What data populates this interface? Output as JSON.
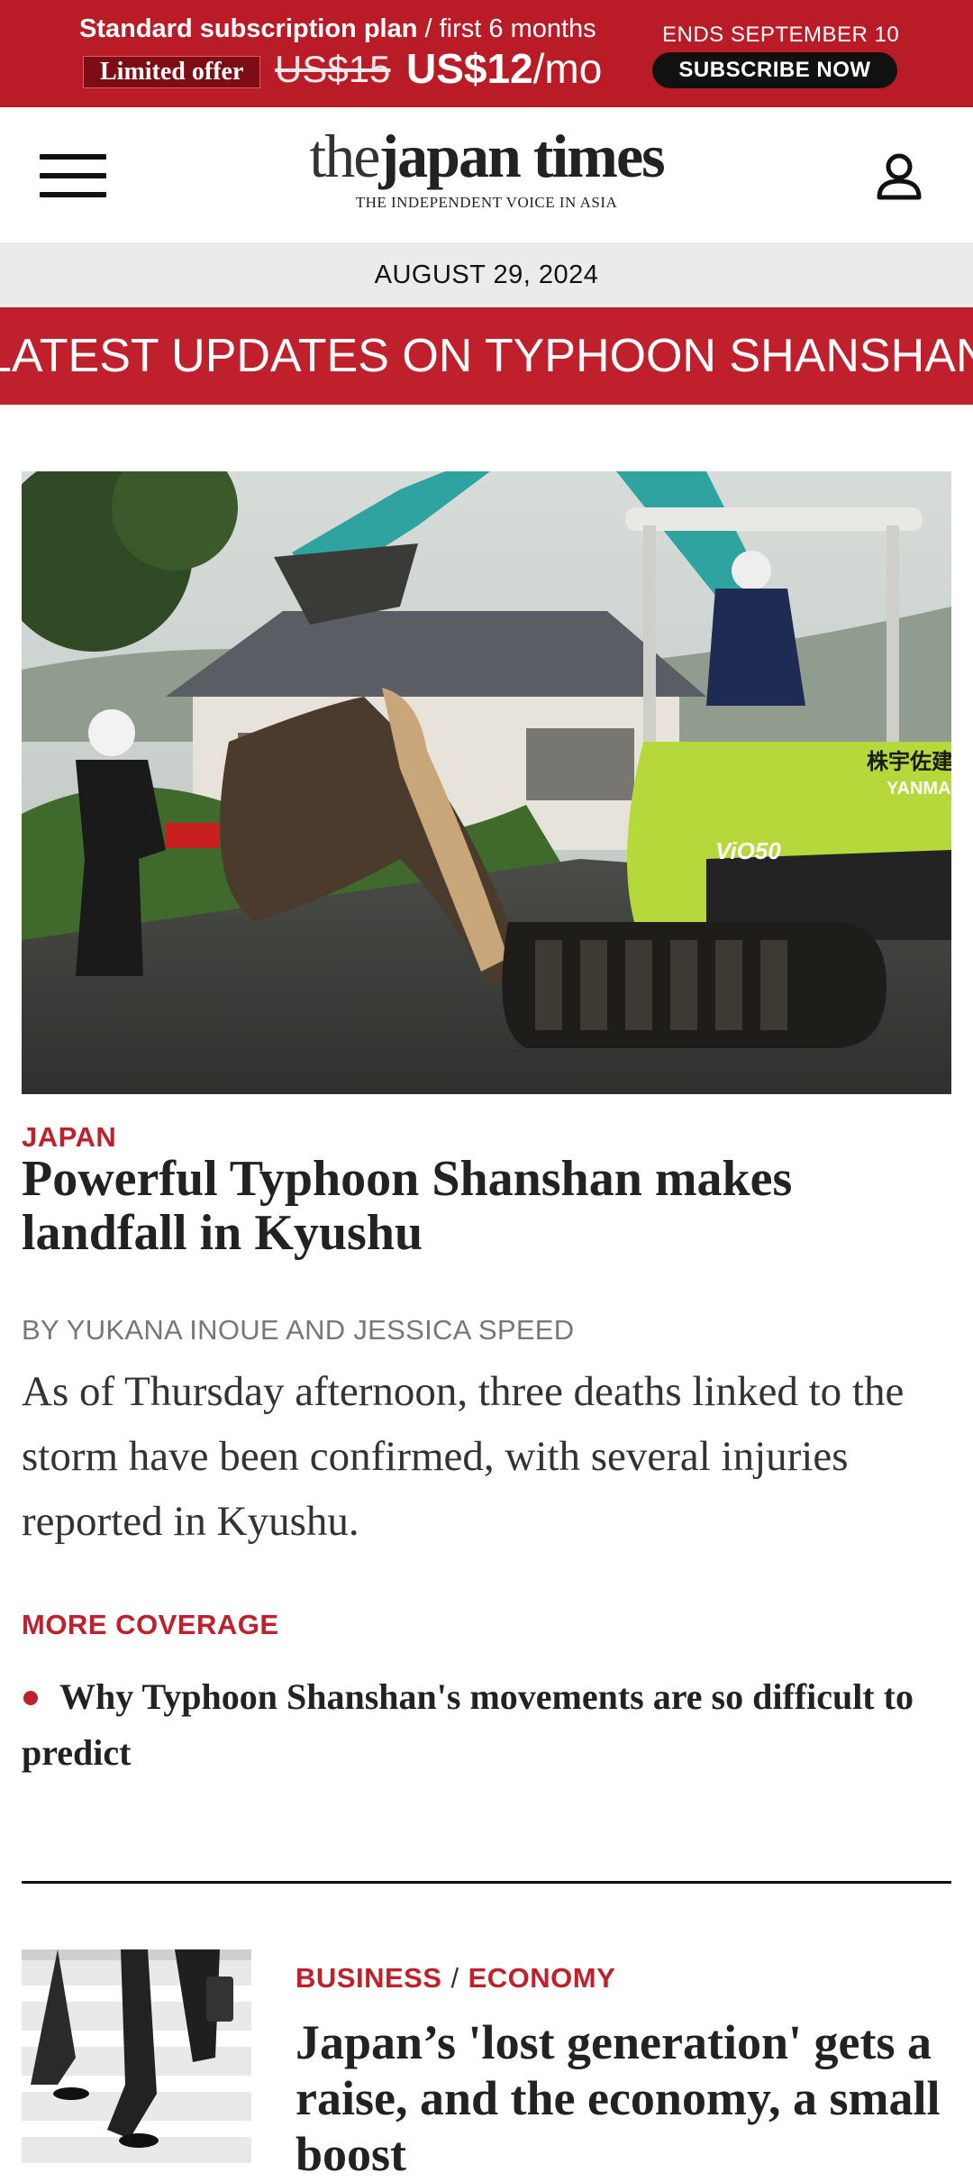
{
  "promo": {
    "plan_bold": "Standard subscription plan",
    "plan_rest": " / first 6 months",
    "limited": "Limited offer",
    "old_price": "US$15",
    "new_price": "US$12",
    "per": "/mo",
    "ends": "ENDS SEPTEMBER 10",
    "subscribe": "SUBSCRIBE NOW"
  },
  "header": {
    "logo_the": "the",
    "logo_japan": "japan",
    "logo_times": " times",
    "tagline": "THE INDEPENDENT VOICE IN ASIA",
    "menu_icon": "hamburger-menu-icon",
    "account_icon": "user-account-icon"
  },
  "date": "AUGUST 29, 2024",
  "ticker": "LATEST UPDATES ON TYPHOON SHANSHAN",
  "lead": {
    "section": "JAPAN",
    "headline": "Powerful Typhoon Shanshan makes landfall in Kyushu",
    "byline": "BY YUKANA INOUE AND JESSICA SPEED",
    "summary": "As of Thursday afternoon, three deaths linked to the storm have been confirmed, with several injuries reported in Kyushu.",
    "photo_text_1": "株宇佐建",
    "photo_text_2": "YANMA",
    "photo_text_3": "ViO50"
  },
  "more_coverage": {
    "label": "MORE COVERAGE",
    "items": [
      "Why Typhoon Shanshan's movements are so difficult to predict"
    ]
  },
  "second": {
    "category_1": "BUSINESS",
    "separator": "/",
    "category_2": "ECONOMY",
    "headline": "Japan’s 'lost generation' gets a raise, and the economy, a small boost"
  },
  "colors": {
    "brand_red": "#c0202b",
    "promo_red": "#b91c26",
    "date_bg": "#ebebeb"
  }
}
